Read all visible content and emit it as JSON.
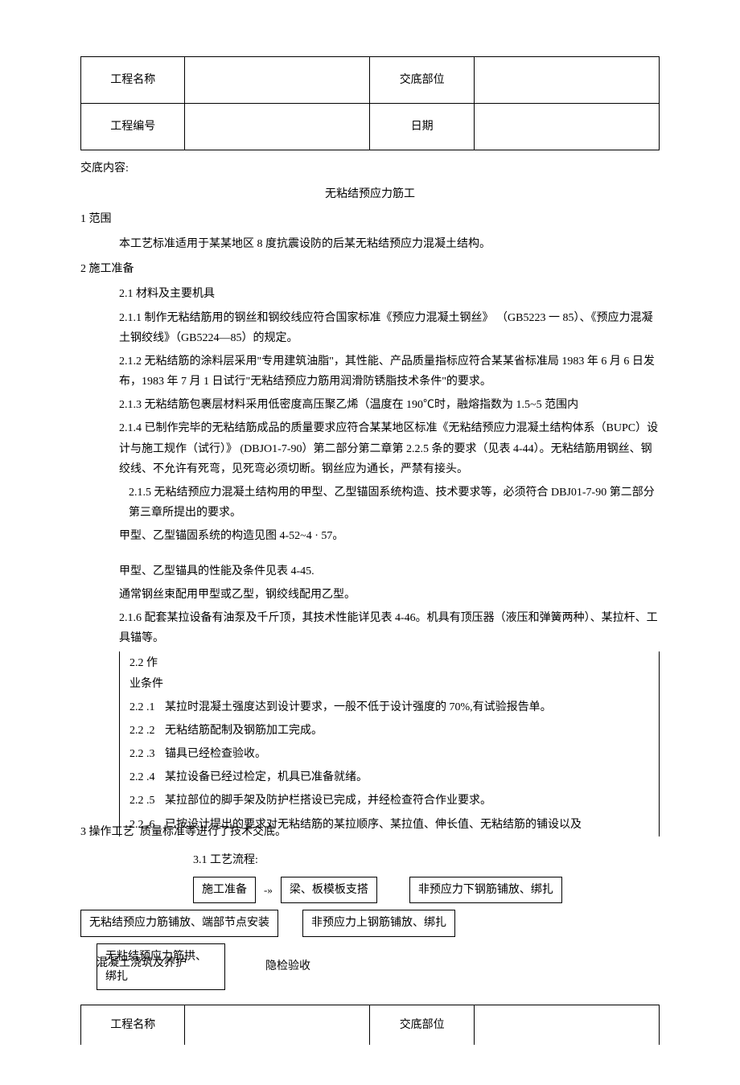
{
  "header_table": {
    "project_name_label": "工程名称",
    "project_name_value": "",
    "disclosure_part_label": "交底部位",
    "disclosure_part_value": "",
    "project_number_label": "工程编号",
    "project_number_value": "",
    "date_label": "日期",
    "date_value": ""
  },
  "disclosure_content_label": "交底内容:",
  "main_title": "无粘结预应力筋工",
  "s1": {
    "heading": "1 范围",
    "p1": "本工艺标准适用于某某地区 8 度抗震设防的后某无粘结预应力混凝土结构。"
  },
  "s2": {
    "heading": "2 施工准备",
    "s2_1": "2.1    材料及主要机具",
    "s2_1_1": "2.1.1  制作无粘结筋用的钢丝和钢绞线应符合国家标准《预应力混凝土钢丝》 （GB5223 一 85）、《预应力混凝土钢绞线》（GB5224—85）的规定。",
    "s2_1_2": "2.1.2  无粘结筋的涂料层采用\"专用建筑油脂\"，其性能、产品质量指标应符合某某省标准局 1983 年 6 月 6 日发布，1983 年 7 月 1 日试行\"无粘结预应力筋用润滑防锈脂技术条件\"的要求。",
    "s2_1_3": "2.1.3  无粘结筋包裹层材料采用低密度高压聚乙烯（温度在 190℃时，融熔指数为 1.5~5 范围内",
    "s2_1_4": "2.1.4  已制作完毕的无粘结筋成品的质量要求应符合某某地区标准《无粘结预应力混凝土结构体系（BUPC）设计与施工规作（试行）》 (DBJO1-7-90）第二部分第二章第 2.2.5 条的要求（见表 4-44）。无粘结筋用钢丝、钢绞线、不允许有死弯，见死弯必须切断。钢丝应为通长，严禁有接头。",
    "s2_1_5": "2.1.5    无粘结预应力混凝土结构用的甲型、乙型锚固系统构造、技术要求等，必须符合  DBJ01-7-90 第二部分第三章所提出的要求。",
    "s2_1_5_sub1": "甲型、乙型锚固系统的构造见图 4-52~4 · 57。",
    "s2_1_5_sub2": "甲型、乙型锚具的性能及条件见表 4-45.",
    "s2_1_5_sub3": "通常钢丝束配用甲型或乙型，钢绞线配用乙型。",
    "s2_1_6": "2.1.6  配套某拉设备有油泵及千斤顶，其技术性能详见表 4-46。机具有顶压器（液压和弹簧两种）、某拉杆、工具锚等。",
    "s2_2": "2.2    作业条件",
    "s2_2_items": [
      {
        "num": "2.2  .1",
        "text": "某拉时混凝土强度达到设计要求，一般不低于设计强度的 70%,有试验报告单。"
      },
      {
        "num": "2.2  .2",
        "text": "无粘结筋配制及钢筋加工完成。"
      },
      {
        "num": "2.2  .3",
        "text": "锚具已经检查验收。"
      },
      {
        "num": "2.2  .4",
        "text": "某拉设备已经过检定，机具已准备就绪。"
      },
      {
        "num": "2.2  .5",
        "text": "某拉部位的脚手架及防护栏搭设已完成，并经检查符合作业要求。"
      },
      {
        "num": "2.2  .6",
        "text": "已按设计提出的要求对无粘结筋的某拉顺序、某拉值、伸长值、无粘结筋的铺设以及"
      }
    ],
    "s2_2_6_cont": "质量标准等进行了技术交底。"
  },
  "s3": {
    "heading": "3 操作工艺",
    "flow_label": "3.1 工艺流程:",
    "row1": {
      "b1": "施工准备",
      "arrow": "-»",
      "b2": "梁、板模板支搭",
      "b3": "非预应力下钢筋铺放、绑扎"
    },
    "row2": {
      "b1": "无粘结预应力筋铺放、端部节点安装",
      "b2": "非预应力上钢筋铺放、绑扎"
    },
    "row3": {
      "b1_line1": "无粘结预应力筋拱、绑扎",
      "overlay": "混凝土浇筑及养护",
      "t2": "隐检验收"
    }
  },
  "footer_table": {
    "project_name_label": "工程名称",
    "project_name_value": "",
    "disclosure_part_label": "交底部位",
    "disclosure_part_value": ""
  }
}
